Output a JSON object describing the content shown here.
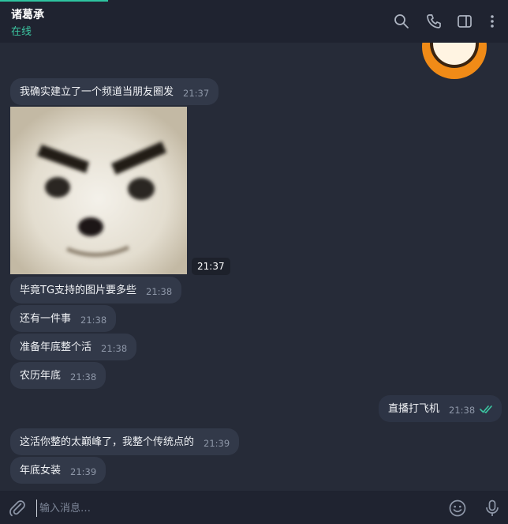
{
  "header": {
    "title": "诸葛承",
    "status": "在线",
    "icons": [
      "search-icon",
      "phone-icon",
      "sidebar-toggle-icon",
      "more-vertical-icon"
    ]
  },
  "messages": [
    {
      "text": "我确实建立了一个频道当朋友圈发",
      "time": "21:37"
    },
    {
      "photo_time": "21:37"
    },
    {
      "text": "毕竟TG支持的图片要多些",
      "time": "21:38"
    },
    {
      "text": "还有一件事",
      "time": "21:38"
    },
    {
      "text": "准备年底整个活",
      "time": "21:38"
    },
    {
      "text": "农历年底",
      "time": "21:38"
    },
    {
      "text": "直播打飞机",
      "time": "21:38",
      "outgoing": true,
      "read": true
    },
    {
      "text": "这活你整的太巅峰了，我整个传统点的",
      "time": "21:39"
    },
    {
      "text": "年底女装",
      "time": "21:39"
    }
  ],
  "composer": {
    "placeholder": "输入消息…",
    "icons": [
      "attach-icon",
      "emoji-icon",
      "microphone-icon"
    ]
  },
  "colors": {
    "background": "#262b38",
    "header": "#1f2330",
    "bubble": "#323949",
    "accent": "#3cc7a2"
  }
}
